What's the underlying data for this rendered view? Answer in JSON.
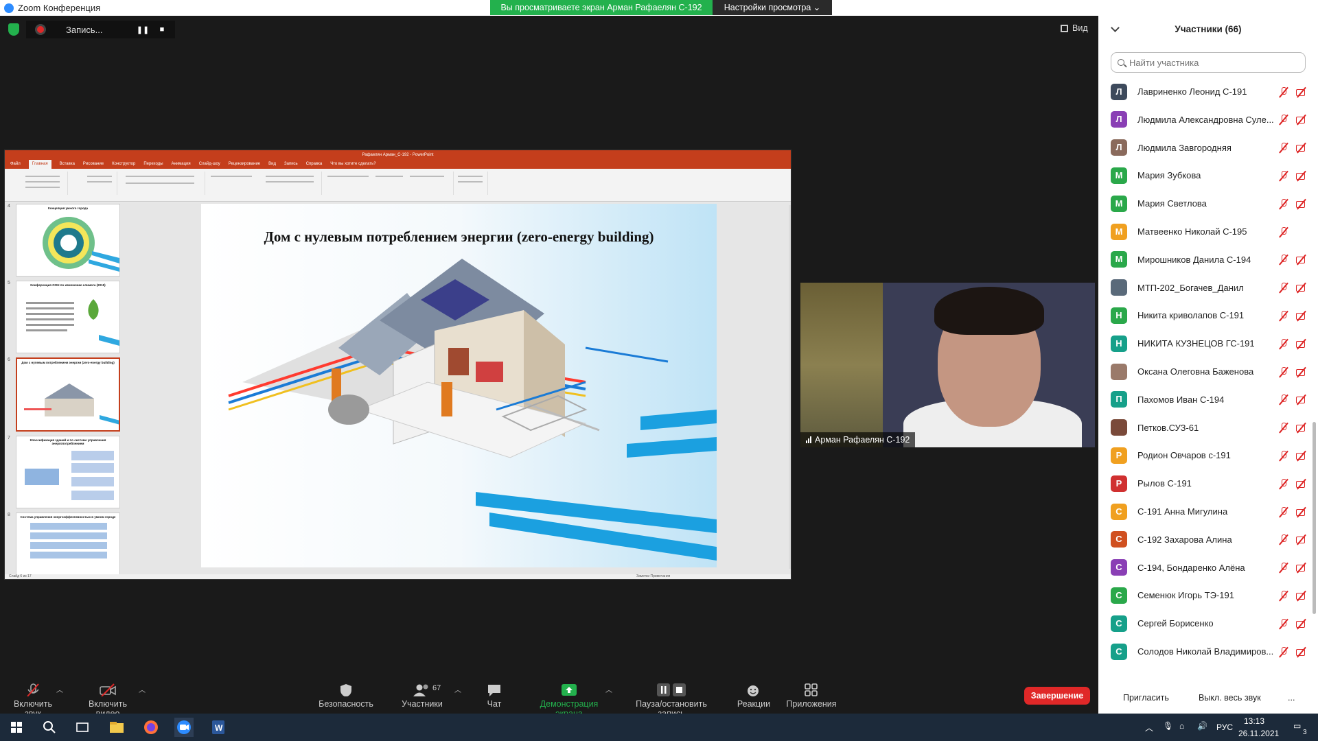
{
  "window": {
    "title": "Zoom Конференция",
    "share_banner": "Вы просматриваете экран Арман Рафаелян С-192",
    "view_options": "Настройки просмотра",
    "view_label": "Вид"
  },
  "recording": {
    "label": "Запись..."
  },
  "shared_screen": {
    "pp_title": "Рафаелян Арман_С-192 - PowerPoint",
    "tabs": [
      "Файл",
      "Главная",
      "Вставка",
      "Рисование",
      "Конструктор",
      "Переходы",
      "Анимация",
      "Слайд-шоу",
      "Рецензирование",
      "Вид",
      "Запись",
      "Справка",
      "Что вы хотите сделать?"
    ],
    "slide_title": "Дом с нулевым потреблением энергии (zero-energy building)",
    "thumbnails": [
      {
        "num": "4",
        "title": "Концепция умного города"
      },
      {
        "num": "5",
        "title": "Конференция ООН по изменению климата (2015)"
      },
      {
        "num": "6",
        "title": "Дом с нулевым потреблением энергии (zero-energy building)"
      },
      {
        "num": "7",
        "title": "Классификация зданий и по системе управления энергопотреблением"
      },
      {
        "num": "8",
        "title": "Система управления энергоэффективностью в умном городе"
      }
    ],
    "status_left": "Слайд 6 из 17",
    "status_right": "Заметки   Примечания"
  },
  "camera": {
    "name": "Арман Рафаелян С-192"
  },
  "participants_panel": {
    "title": "Участники (66)",
    "search_placeholder": "Найти участника",
    "items": [
      {
        "initial": "Л",
        "name": "Лавриненко Леонид С-191",
        "color": "#3d4a5c",
        "cam": true
      },
      {
        "initial": "Л",
        "name": "Людмила Александровна Суле...",
        "color": "#8a3fb5",
        "cam": true
      },
      {
        "initial": "Л",
        "name": "Людмила Завгородняя",
        "color": "#8a6a5c",
        "cam": true
      },
      {
        "initial": "М",
        "name": "Мария Зубкова",
        "color": "#2aa84a",
        "cam": true
      },
      {
        "initial": "М",
        "name": "Мария Светлова",
        "color": "#2aa84a",
        "cam": true
      },
      {
        "initial": "М",
        "name": "Матвеенко Николай С-195",
        "color": "#f0a020",
        "cam": false
      },
      {
        "initial": "М",
        "name": "Мирошников Данила С-194",
        "color": "#2aa84a",
        "cam": true
      },
      {
        "initial": "",
        "name": "МТП-202_Богачев_Данил",
        "color": "#5a6a7a",
        "cam": true
      },
      {
        "initial": "Н",
        "name": "Никита криволапов С-191",
        "color": "#2aa84a",
        "cam": true
      },
      {
        "initial": "Н",
        "name": "НИКИТА КУЗНЕЦОВ ГС-191",
        "color": "#16a08a",
        "cam": true
      },
      {
        "initial": "",
        "name": "Оксана Олеговна Баженова",
        "color": "#9a7a6a",
        "cam": true
      },
      {
        "initial": "П",
        "name": "Пахомов Иван С-194",
        "color": "#16a08a",
        "cam": true
      },
      {
        "initial": "",
        "name": "Петков.СУЗ-61",
        "color": "#7a4a3a",
        "cam": true
      },
      {
        "initial": "Р",
        "name": "Родион Овчаров с-191",
        "color": "#f0a020",
        "cam": true
      },
      {
        "initial": "Р",
        "name": "Рылов С-191",
        "color": "#d03030",
        "cam": true
      },
      {
        "initial": "С",
        "name": "С-191 Анна Мигулина",
        "color": "#f0a020",
        "cam": true
      },
      {
        "initial": "С",
        "name": "С-192 Захарова Алина",
        "color": "#d05020",
        "cam": true
      },
      {
        "initial": "С",
        "name": "С-194, Бондаренко Алёна",
        "color": "#8a3fb5",
        "cam": true
      },
      {
        "initial": "С",
        "name": "Семенюк Игорь ТЭ-191",
        "color": "#2aa84a",
        "cam": true
      },
      {
        "initial": "С",
        "name": "Сергей Борисенко",
        "color": "#16a08a",
        "cam": true
      },
      {
        "initial": "С",
        "name": "Солодов Николай Владимиров...",
        "color": "#16a08a",
        "cam": true
      }
    ],
    "invite": "Пригласить",
    "mute_all": "Выкл. весь звук",
    "more": "..."
  },
  "toolbar": {
    "unmute": "Включить звук",
    "start_video": "Включить видео",
    "security": "Безопасность",
    "participants": "Участники",
    "participants_count": "67",
    "chat": "Чат",
    "share": "Демонстрация экрана",
    "pause_record": "Пауза/остановить запись",
    "reactions": "Реакции",
    "apps": "Приложения",
    "end": "Завершение"
  },
  "taskbar": {
    "lang": "РУС",
    "time": "13:13",
    "date": "26.11.2021",
    "notif": "3"
  },
  "colors": {
    "zoom_blue": "#2d8cff",
    "share_green": "#23b14d",
    "end_red": "#e02828",
    "ppt_orange": "#c43e1c"
  }
}
